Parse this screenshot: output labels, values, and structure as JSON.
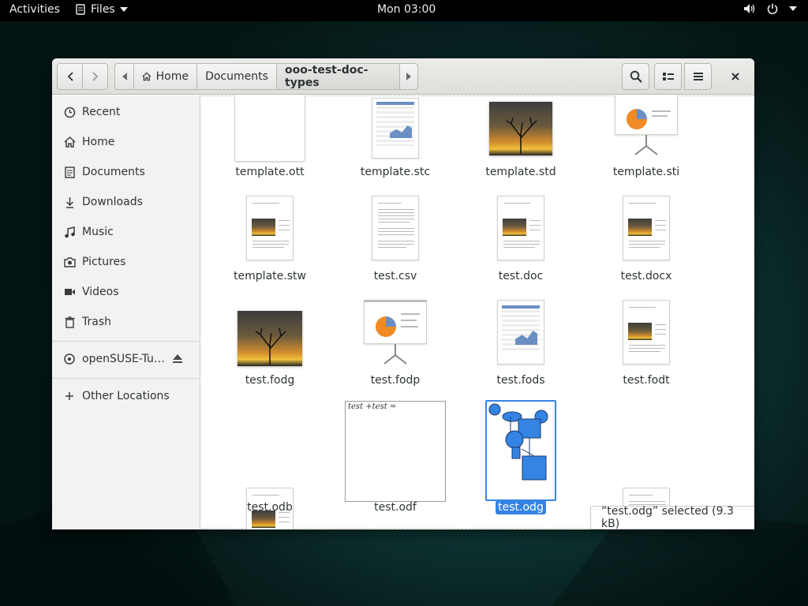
{
  "topbar": {
    "activities": "Activities",
    "app_menu": "Files",
    "clock": "Mon 03:00"
  },
  "breadcrumbs": [
    {
      "label": "Home"
    },
    {
      "label": "Documents"
    },
    {
      "label": "ooo-test-doc-types"
    }
  ],
  "sidebar": {
    "items": [
      {
        "label": "Recent",
        "icon": "clock-icon"
      },
      {
        "label": "Home",
        "icon": "home-icon"
      },
      {
        "label": "Documents",
        "icon": "document-icon"
      },
      {
        "label": "Downloads",
        "icon": "download-icon"
      },
      {
        "label": "Music",
        "icon": "music-icon"
      },
      {
        "label": "Pictures",
        "icon": "camera-icon"
      },
      {
        "label": "Videos",
        "icon": "video-icon"
      },
      {
        "label": "Trash",
        "icon": "trash-icon"
      }
    ],
    "device": {
      "label": "openSUSE-Tu…",
      "icon": "disc-icon"
    },
    "other": {
      "label": "Other Locations",
      "icon": "plus-icon"
    }
  },
  "files": [
    {
      "name": "template.ott"
    },
    {
      "name": "template.stc"
    },
    {
      "name": "template.std"
    },
    {
      "name": "template.sti"
    },
    {
      "name": "template.stw"
    },
    {
      "name": "test.csv"
    },
    {
      "name": "test.doc"
    },
    {
      "name": "test.docx"
    },
    {
      "name": "test.fodg"
    },
    {
      "name": "test.fodp"
    },
    {
      "name": "test.fods"
    },
    {
      "name": "test.fodt"
    },
    {
      "name": "test.odb"
    },
    {
      "name": "test.odf"
    },
    {
      "name": "test.odg"
    },
    {
      "name": ""
    }
  ],
  "odf_preview_text": "test +test =",
  "status": "“test.odg” selected  (9.3 kB)",
  "colors": {
    "accent": "#3584e4",
    "topbar": "#000000"
  }
}
